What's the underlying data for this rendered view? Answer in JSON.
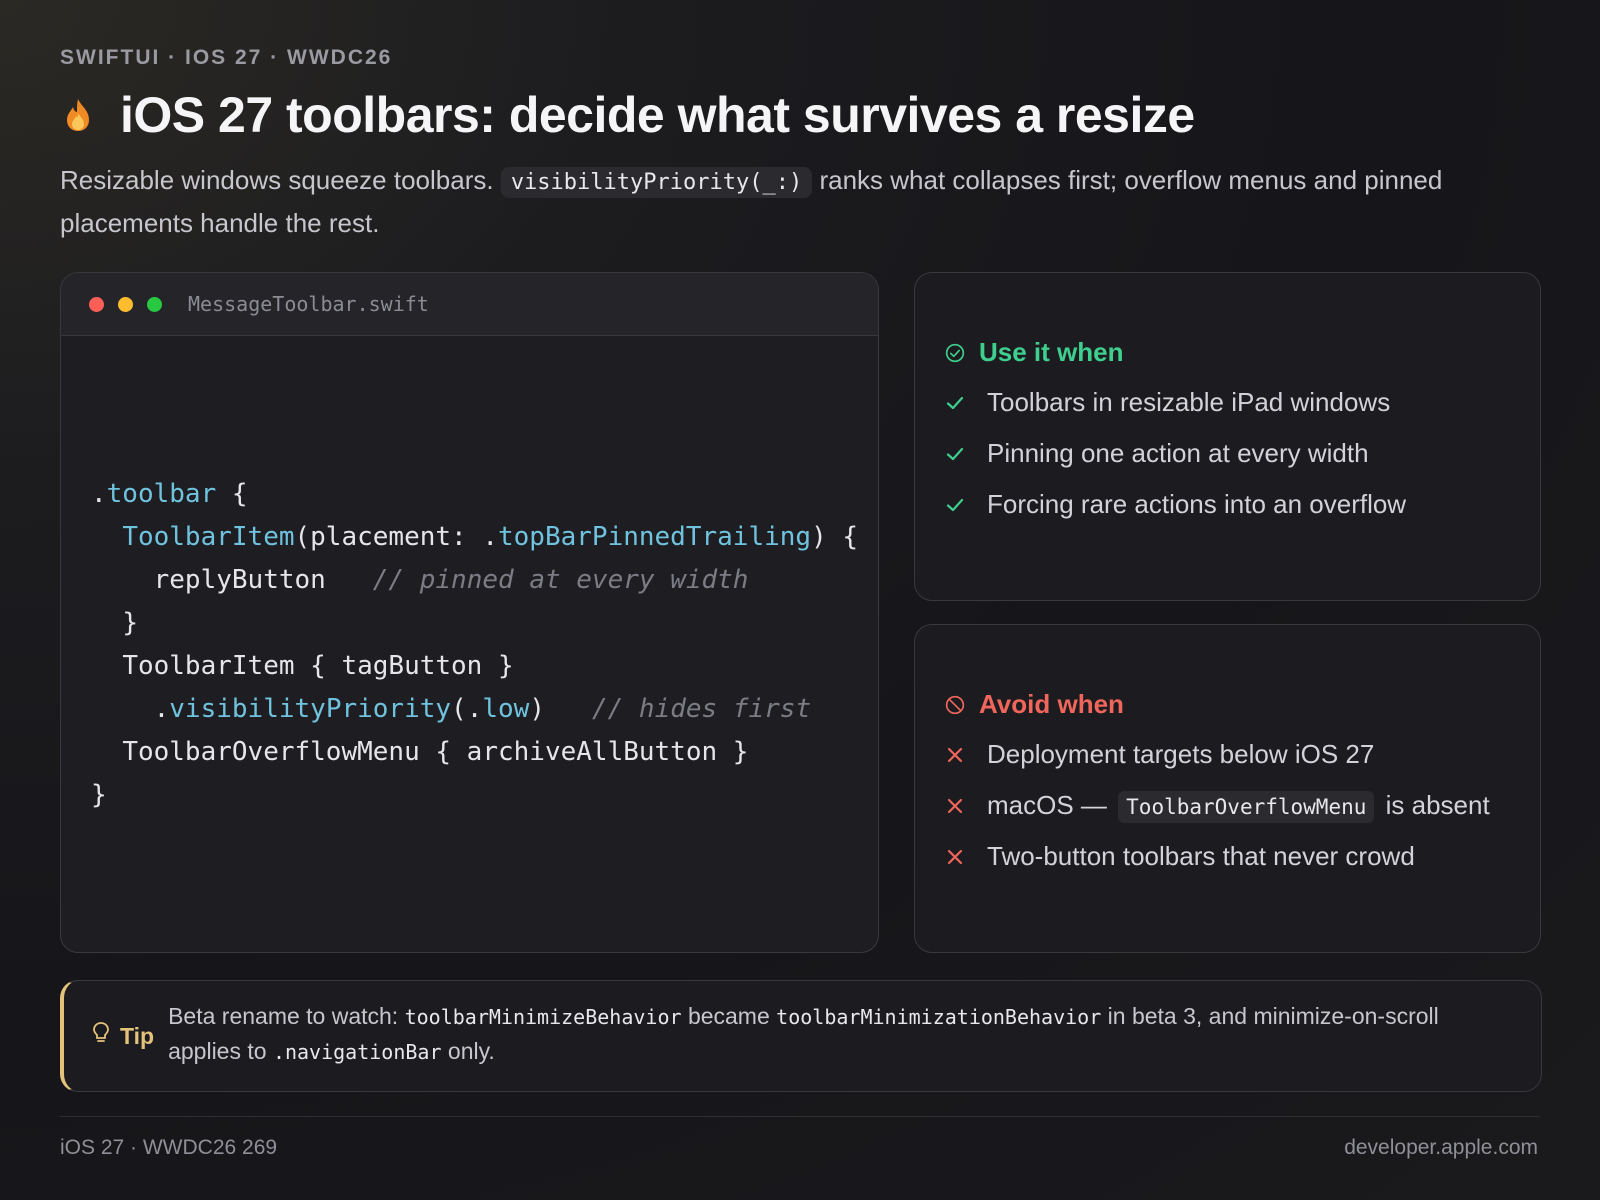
{
  "eyebrow": "SWIFTUI · IOS 27 · WWDC26",
  "title": "iOS 27 toolbars: decide what survives a resize",
  "title_icon": "flame-icon",
  "lede": {
    "before": "Resizable windows squeeze toolbars.",
    "code": "visibilityPriority(_:)",
    "after": "ranks what collapses first; overflow menus and pinned placements handle the rest."
  },
  "editor": {
    "filename": "MessageToolbar.swift",
    "window_dots": [
      "#ff5f57",
      "#febc2e",
      "#28c840"
    ],
    "lines": {
      "l1_dot": ".",
      "l1_kw": "toolbar",
      "l1_end": " {",
      "l2_kw": "ToolbarItem",
      "l2_mid": "(placement: .",
      "l2_kw2": "topBarPinnedTrailing",
      "l2_end": ") {",
      "l3_code": "replyButton",
      "l3_comment": "// pinned at every width",
      "l4": "}",
      "l5": "ToolbarItem { tagButton }",
      "l6_dot": ".",
      "l6_kw": "visibilityPriority",
      "l6_mid": "(.",
      "l6_kw2": "low",
      "l6_end": ")",
      "l6_comment": "// hides first",
      "l7": "ToolbarOverflowMenu { archiveAllButton }",
      "l8": "}"
    }
  },
  "use_card": {
    "title": "Use it when",
    "color": "#3ecf8e",
    "items": [
      "Toolbars in resizable iPad windows",
      "Pinning one action at every width",
      "Forcing rare actions into an overflow"
    ]
  },
  "avoid_card": {
    "title": "Avoid when",
    "color": "#f0665a",
    "items": {
      "i0": "Deployment targets below iOS 27",
      "i1_before": "macOS —",
      "i1_code": "ToolbarOverflowMenu",
      "i1_after": "is absent",
      "i2": "Two-button toolbars that never crowd"
    }
  },
  "tip": {
    "label": "Tip",
    "t1": "Beta rename to watch:",
    "c1": "toolbarMinimizeBehavior",
    "t2": "became",
    "c2": "toolbarMinimizationBehavior",
    "t3": "in beta 3, and minimize-on-scroll applies to",
    "c3": ".navigationBar",
    "t4": "only."
  },
  "footer": {
    "left": "iOS 27 · WWDC26 269",
    "right": "developer.apple.com"
  }
}
